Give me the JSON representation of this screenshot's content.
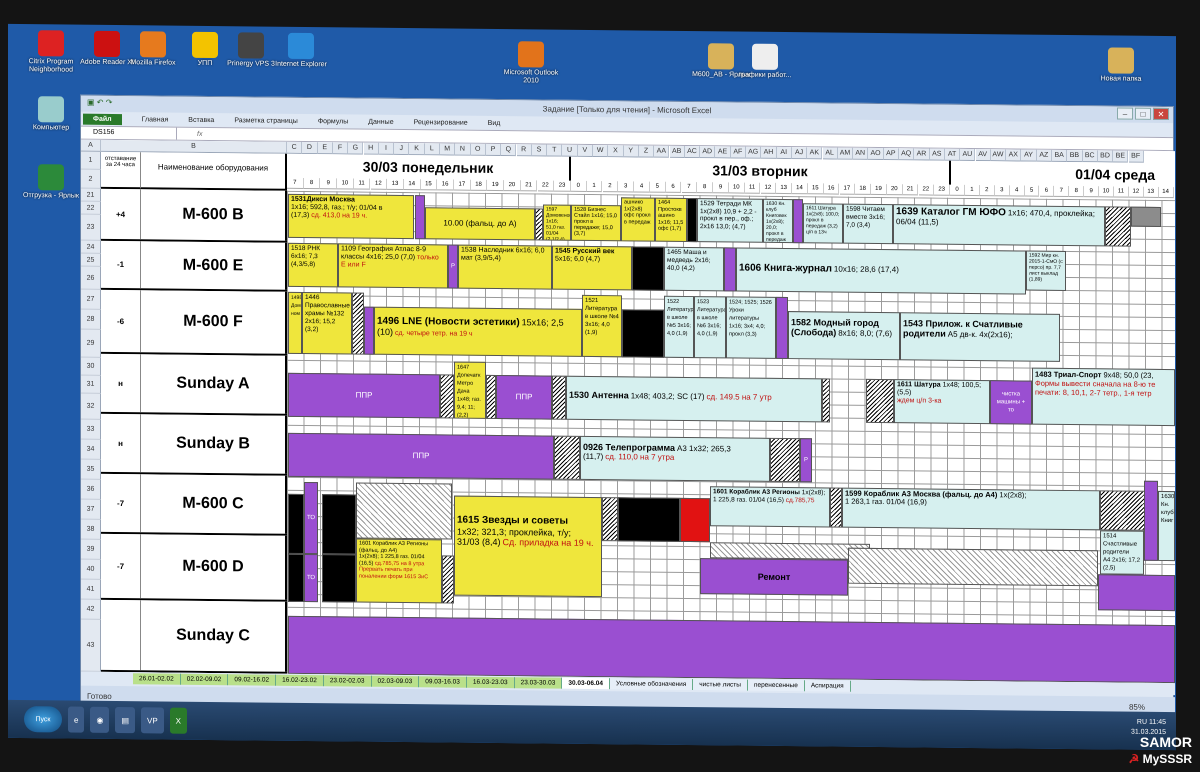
{
  "desktop": {
    "icons": [
      {
        "label": "Citrix Program Neighborhood",
        "color": "#d22"
      },
      {
        "label": "Adobe Reader XI",
        "color": "#c11"
      },
      {
        "label": "Mozilla Firefox",
        "color": "#e67a1e"
      },
      {
        "label": "УПП",
        "color": "#f3c300"
      },
      {
        "label": "Prinergy VPS 3",
        "color": "#444"
      },
      {
        "label": "Internet Explorer",
        "color": "#2b8ad8"
      },
      {
        "label": "Microsoft Outlook 2010",
        "color": "#e2731b"
      },
      {
        "label": "M600_AB - Ярлык",
        "color": "#d8b25a"
      },
      {
        "label": "графики работ...",
        "color": "#eee"
      },
      {
        "label": "Новая папка",
        "color": "#d8b25a"
      },
      {
        "label": "Компьютер",
        "color": "#9cc"
      },
      {
        "label": "Отгрузка - Ярлык",
        "color": "#2c8a3a"
      }
    ]
  },
  "excel": {
    "title": "Задание [Только для чтения] - Microsoft Excel",
    "name_box": "DS156",
    "fx": "fx",
    "ribbon_tabs": [
      "Файл",
      "Главная",
      "Вставка",
      "Разметка страницы",
      "Формулы",
      "Данные",
      "Рецензирование",
      "Вид"
    ],
    "col_letters": [
      "A",
      "B",
      "C",
      "D",
      "E",
      "F",
      "G",
      "H",
      "I",
      "J",
      "K",
      "L",
      "M",
      "N",
      "O",
      "P",
      "Q",
      "R",
      "S",
      "T",
      "U",
      "V",
      "W",
      "X",
      "Y",
      "Z",
      "AA",
      "AB",
      "AC",
      "AD",
      "AE",
      "AF",
      "AG",
      "AH",
      "AI",
      "AJ",
      "AK",
      "AL",
      "AM",
      "AN",
      "AO",
      "AP",
      "AQ",
      "AR",
      "AS",
      "AT",
      "AU",
      "AV",
      "AW",
      "AX",
      "AY",
      "AZ",
      "BA",
      "BB",
      "BC",
      "BD",
      "BE",
      "BF"
    ],
    "hdr_left": "отставание за 24 часа",
    "hdr_name": "Наименование оборудования",
    "days": [
      "30/03 понедельник",
      "31/03 вторник",
      "01/04 среда"
    ],
    "hours1": [
      "7",
      "8",
      "9",
      "10",
      "11",
      "12",
      "13",
      "14",
      "15",
      "16",
      "17",
      "18",
      "19",
      "20",
      "21",
      "22",
      "23"
    ],
    "hours2": [
      "0",
      "1",
      "2",
      "3",
      "4",
      "5",
      "6",
      "7",
      "8",
      "9",
      "10",
      "11",
      "12",
      "13",
      "14",
      "15",
      "16",
      "17",
      "18",
      "19",
      "20",
      "21",
      "22",
      "23"
    ],
    "hours3": [
      "0",
      "1",
      "2",
      "3",
      "4",
      "5",
      "6",
      "7",
      "8",
      "9",
      "10",
      "11",
      "12",
      "13",
      "14"
    ],
    "rows": [
      "1",
      "2",
      "21",
      "22",
      "23",
      "24",
      "25",
      "26",
      "27",
      "28",
      "29",
      "30",
      "31",
      "32",
      "33",
      "34",
      "35",
      "36",
      "37",
      "38",
      "39",
      "40",
      "41",
      "42",
      "43"
    ],
    "equipment": [
      {
        "shift": "+4",
        "name": "M-600 B"
      },
      {
        "shift": "-1",
        "name": "M-600 E"
      },
      {
        "shift": "-6",
        "name": "M-600 F"
      },
      {
        "shift": "н",
        "name": "Sunday A"
      },
      {
        "shift": "н",
        "name": "Sunday B"
      },
      {
        "shift": "-7",
        "name": "M-600 C"
      },
      {
        "shift": "-7",
        "name": "M-600 D"
      },
      {
        "shift": "",
        "name": "Sunday C"
      }
    ],
    "jobs": {
      "b1": "1531Дикси Москва",
      "b1b": "1х16; 592,8, газ.; т/у; 01/04 в",
      "b1c": "(17,3)",
      "b1d": "сд. 413,0 на 19 ч.",
      "b2": "10.00 (фальц. до А)",
      "b3": "1597 Домовенок 1х16; 51,0 газ. 01/04 (2,1/2,4)",
      "b4": "1528 Бизнес Стайл 1х16; 15,0 прокл в передаже; 15,0 (3,7)",
      "b5": "ашнико 1х(2х8) офс прокл в передаж",
      "b6": "1464 Простокв ашино 1х16; 11,5 офс (1,7)",
      "b7": "1529 Тетради МК 1х(2х8) 10,9 + 2,2 - прокл в пер., оф.; 2х16 13,0; (4,7)",
      "b8": "1630 Кн. клуб Книговек 1х(2х8); 20,0; прокл в передаж (2,3)",
      "b9": "1611 Шатура 1х(2х8); 100,0; прокл в передаж (3,2) ц/п в 13ч",
      "b10": "1598 Читаем вместе 3х16; 7,0 (3,4)",
      "b11": "1639 Каталог ГМ ЮФО",
      "b11b": "1х16; 470,4, проклейка; 06/04 (11,5)",
      "e1": "1518 РНК 6х16; 7,3 (4,3/5,8)",
      "e2": "1109 География Атлас 8-9 классы 4х16; 25,0 (7,0)",
      "e2b": "только Е или F",
      "e3": "1538 Наследник 6х16; 6,0 мат (3,9/5,4)",
      "e4": "1545 Русский век",
      "e4b": "5х16; 6,0 (4,7)",
      "e5": "1465 Маша и медведь 2х16; 40,0 (4,2)",
      "e6": "1606 Книга-журнал",
      "e6b": "10х16; 28,6 (17,4)",
      "e7": "1592 Мир кн. 2015-1-СмО (с персо) пр. 7,7 лист выклад (1,89)",
      "f1": "1498 Дом ном",
      "f2": "1446 Православные храмы №132",
      "f2b": "2х16; 15,2 (3,2)",
      "f3": "1496 LNE (Новости эстетики)",
      "f3b": "15х16; 2,5",
      "f3c": "(10)",
      "f3d": "сд. четыре тетр. на 19 ч",
      "f4": "1521 Литература в школе №4 3х16; 4,0 (1,9)",
      "f5": "1522 Литература в школе №5 3х16; 4,0 (1,9)",
      "f6": "1523 Литература в школе №6 3х16; 4,0 (1,9)",
      "f7": "1524; 1525; 1526 Уроки литературы 1х16; 3х4; 4,0; прокл (3,3)",
      "f8": "1582 Модный город (Слобода)",
      "f8b": "8х16; 8,0; (7,6)",
      "f9": "1543 Прилож. к Счатливые родители",
      "f9b": "А5 дв-к. 4х(2х16);",
      "sa1": "ППР",
      "sa2": "1647 Допечатк Метро Дача",
      "sa2b": "1х48; газ. 9,4; 11; (2,2)",
      "sa3": "ППР",
      "sa4": "1530 Антенна",
      "sa4b": "1х48; 403,2; SC (17)",
      "sa4c": "сд. 149.5 на 7 утр",
      "sa5": "1611 Шатура",
      "sa5b": "1х48; 100,5; (5,5)",
      "sa5c": "ждем ц/п 3-ка",
      "sa6": "чистка машины + то",
      "sa7": "1483 Триал-Спорт",
      "sa7b": "9х48; 50,0 (23,",
      "sa7c": "Формы вывести сначала на 8-ю те",
      "sa7d": "печати: 8, 10,1, 2-7 тетр., 1-я тетр",
      "sb1": "ППР",
      "sb2": "0926 Телепрограмма",
      "sb2b": "А3 1х32; 265,3",
      "sb2c": "(11,7)",
      "sb2d": "сд. 110,0 на 7 утра",
      "c1": "1615 Звезды и советы",
      "c1b": "1х32; 321,3; проклейка, т/у;",
      "c1c": "31/03 (8,4)",
      "c1d": "Сд. приладка на 19 ч.",
      "c2": "1601 Кораблик А3 Регионы",
      "c2b": "1х(2х8); 1 225,8 газ. 01/04 (16,5)",
      "c2c": "сд.785,75",
      "c3": "1599 Кораблик А3 Москва (фальц. до А4)",
      "c3b": "1х(2х8);",
      "c3c": "1 263,1 газ. 01/04 (16,9)",
      "c4": "1514 Счастливые родители",
      "c4b": "А4 2х16; 17,2 (2,5)",
      "c5": "1630 Кн. клуб Книг",
      "d1": "1601 Кораблик А3 Регионы (фальц. до А4)",
      "d1b": "1х(2х8); 1 225,8 газ. 01/04",
      "d1c": "(16,5)",
      "d1d": "сд.785,75 на 8 утра",
      "d1e": "Прервать печать при поналении форм 1615 ЗиС",
      "d2": "Ремонт",
      "to": "ТО",
      "r": "Р"
    },
    "sheet_tabs": [
      "26.01-02.02",
      "02.02-09.02",
      "09.02-16.02",
      "16.02-23.02",
      "23.02-02.03",
      "02.03-09.03",
      "09.03-16.03",
      "16.03-23.03",
      "23.03-30.03",
      "30.03-06.04",
      "Условные обозначения",
      "чистые листы",
      "перенесенные",
      "Аспирация"
    ],
    "status": "Готово",
    "zoom": "85%"
  },
  "taskbar": {
    "start": "Пуск",
    "lang": "RU",
    "time": "11:45",
    "date": "31.03.2015"
  },
  "watermark": {
    "author": "SAMOR",
    "site": "MySSSR"
  }
}
